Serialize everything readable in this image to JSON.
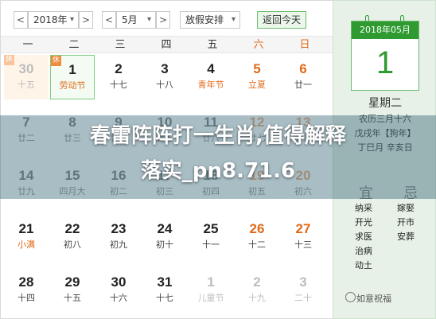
{
  "toolbar": {
    "prev_label": "<",
    "next_label": ">",
    "year": "2018年",
    "month": "5月",
    "holiday": "放假安排",
    "today_button": "返回今天",
    "caret": "▾"
  },
  "weekdays": [
    "一",
    "二",
    "三",
    "四",
    "五",
    "六",
    "日"
  ],
  "weeks": [
    [
      {
        "num": "30",
        "lunar": "十五",
        "muted": true,
        "badge": "休",
        "badge_light": true
      },
      {
        "num": "1",
        "lunar": "劳动节",
        "badge": "休",
        "selected": true,
        "lunar_style": "fest"
      },
      {
        "num": "2",
        "lunar": "十七"
      },
      {
        "num": "3",
        "lunar": "十八"
      },
      {
        "num": "4",
        "lunar": "青年节",
        "lunar_style": "fest"
      },
      {
        "num": "5",
        "lunar": "立夏",
        "wkend": true,
        "lunar_style": "fest"
      },
      {
        "num": "6",
        "lunar": "廿一",
        "wkend": true
      }
    ],
    [
      {
        "num": "7",
        "lunar": "廿二",
        "faded": true
      },
      {
        "num": "8",
        "lunar": "廿三",
        "faded": true
      },
      {
        "num": "9",
        "lunar": "廿四",
        "faded": true
      },
      {
        "num": "10",
        "lunar": "廿五",
        "faded": true
      },
      {
        "num": "11",
        "lunar": "廿六",
        "faded": true
      },
      {
        "num": "12",
        "lunar": "廿七",
        "wkend": true,
        "faded": true
      },
      {
        "num": "13",
        "lunar": "廿八",
        "wkend": true,
        "faded": true
      }
    ],
    [
      {
        "num": "14",
        "lunar": "廿九",
        "faded": true
      },
      {
        "num": "15",
        "lunar": "四月大",
        "faded": true
      },
      {
        "num": "16",
        "lunar": "初二",
        "faded": true
      },
      {
        "num": "17",
        "lunar": "初三",
        "faded": true
      },
      {
        "num": "18",
        "lunar": "初四",
        "faded": true
      },
      {
        "num": "19",
        "lunar": "初五",
        "wkend": true,
        "faded": true
      },
      {
        "num": "20",
        "lunar": "初六",
        "wkend": true,
        "faded": true
      }
    ],
    [
      {
        "num": "21",
        "lunar": "小满",
        "lunar_style": "fest"
      },
      {
        "num": "22",
        "lunar": "初八"
      },
      {
        "num": "23",
        "lunar": "初九"
      },
      {
        "num": "24",
        "lunar": "初十"
      },
      {
        "num": "25",
        "lunar": "十一"
      },
      {
        "num": "26",
        "lunar": "十二",
        "wkend": true
      },
      {
        "num": "27",
        "lunar": "十三",
        "wkend": true
      }
    ],
    [
      {
        "num": "28",
        "lunar": "十四"
      },
      {
        "num": "29",
        "lunar": "十五"
      },
      {
        "num": "30",
        "lunar": "十六"
      },
      {
        "num": "31",
        "lunar": "十七"
      },
      {
        "num": "1",
        "lunar": "儿童节",
        "muted": true
      },
      {
        "num": "2",
        "lunar": "十九",
        "muted": true
      },
      {
        "num": "3",
        "lunar": "二十",
        "muted": true
      }
    ]
  ],
  "detail": {
    "card_header": "2018年05月",
    "card_day": "1",
    "weekday": "星期二",
    "lunar_date": "农历三月十六",
    "ganzhi_year": "戊戌年【狗年】",
    "ganzhi_day": "丁巳月 辛亥日",
    "yi_label": "宜",
    "ji_label": "忌",
    "yi": [
      "纳采",
      "开光",
      "求医",
      "治病",
      "动土"
    ],
    "ji": [
      "嫁娶",
      "开市",
      "安葬"
    ]
  },
  "watermark": "如意祝福",
  "overlay": {
    "line1": "春雷阵阵打一生肖,值得解释",
    "line2": "落实_pn8.71.6"
  },
  "colors": {
    "accent_green": "#2f9a2f",
    "weekend_orange": "#e06a1a"
  }
}
